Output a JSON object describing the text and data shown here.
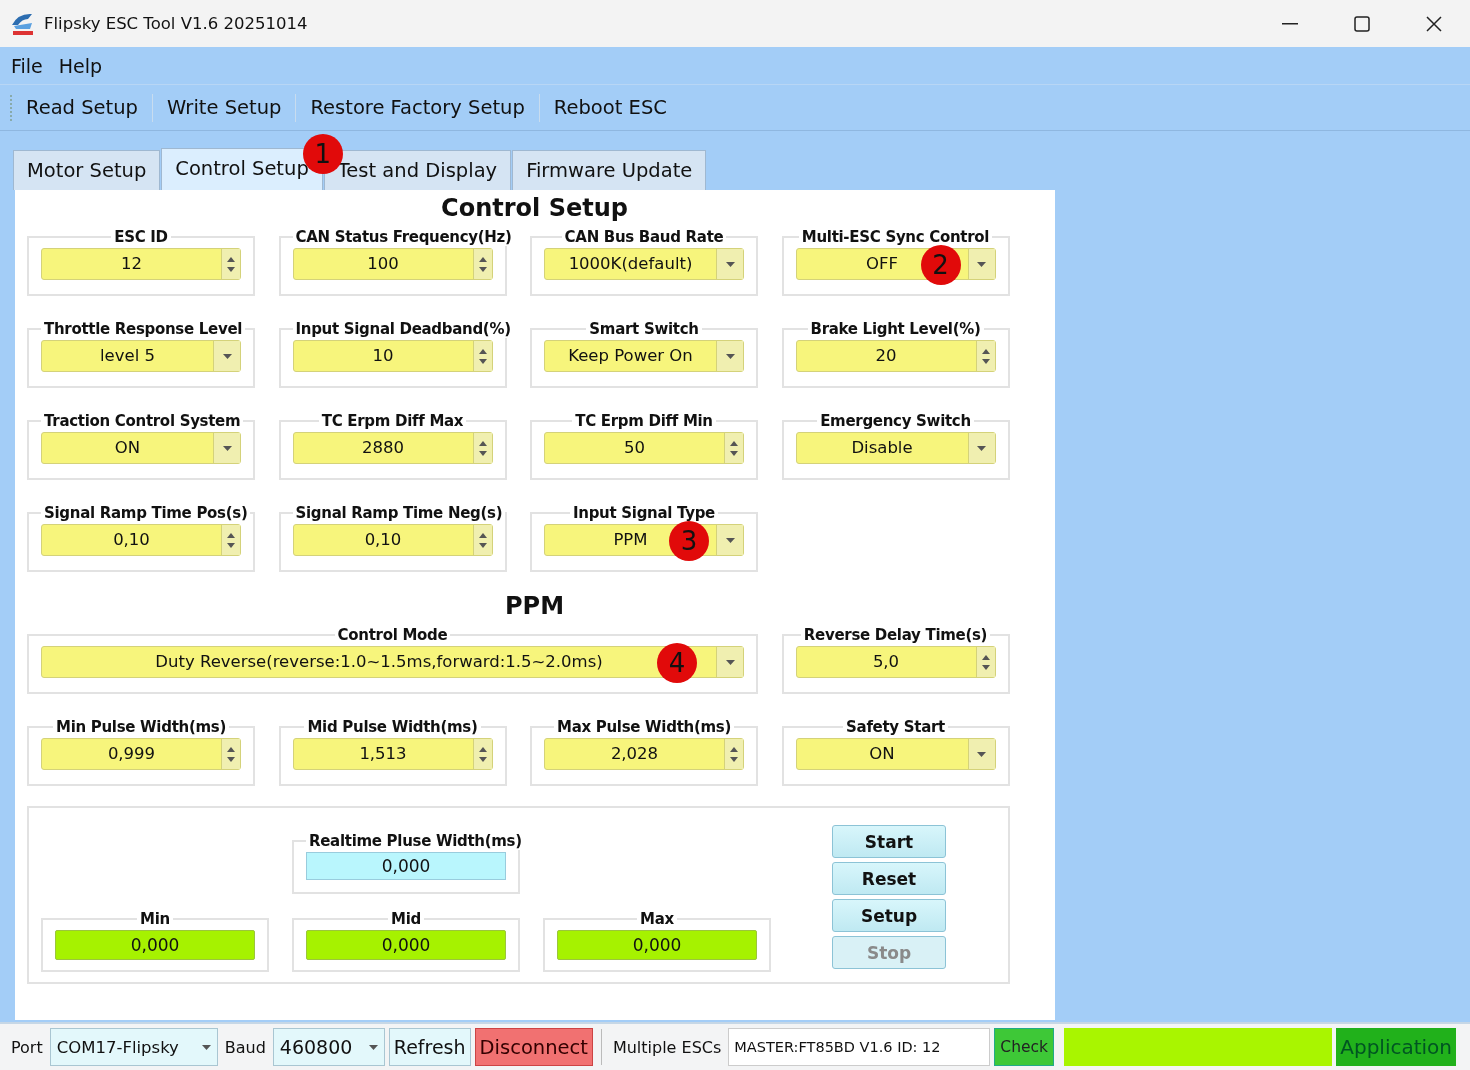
{
  "window": {
    "title": "Flipsky ESC Tool V1.6 20251014"
  },
  "menu": [
    "File",
    "Help"
  ],
  "toolbar": [
    "Read Setup",
    "Write Setup",
    "Restore Factory Setup",
    "Reboot ESC"
  ],
  "tabs": [
    {
      "label": "Motor Setup",
      "selected": false
    },
    {
      "label": "Control Setup",
      "selected": true,
      "callout": "1"
    },
    {
      "label": "Test and Display",
      "selected": false
    },
    {
      "label": "Firmware Update",
      "selected": false
    }
  ],
  "sections": [
    {
      "title": "Control Setup",
      "fields": [
        {
          "label": "ESC ID",
          "value": "12",
          "kind": "spin"
        },
        {
          "label": "CAN Status Frequency(Hz)",
          "value": "100",
          "kind": "spin"
        },
        {
          "label": "CAN Bus Baud Rate",
          "value": "1000K(default)",
          "kind": "combo"
        },
        {
          "label": "Multi-ESC Sync Control",
          "value": "OFF",
          "kind": "combo",
          "callout": "2"
        },
        {
          "label": "Throttle Response Level",
          "value": "level 5",
          "kind": "combo"
        },
        {
          "label": "Input Signal Deadband(%)",
          "value": "10",
          "kind": "spin"
        },
        {
          "label": "Smart Switch",
          "value": "Keep Power On",
          "kind": "combo"
        },
        {
          "label": "Brake Light Level(%)",
          "value": "20",
          "kind": "spin"
        },
        {
          "label": "Traction Control System",
          "value": "ON",
          "kind": "combo"
        },
        {
          "label": "TC Erpm Diff Max",
          "value": "2880",
          "kind": "spin"
        },
        {
          "label": "TC Erpm Diff Min",
          "value": "50",
          "kind": "spin"
        },
        {
          "label": "Emergency Switch",
          "value": "Disable",
          "kind": "combo"
        },
        {
          "label": "Signal Ramp Time Pos(s)",
          "value": "0,10",
          "kind": "spin"
        },
        {
          "label": "Signal Ramp Time Neg(s)",
          "value": "0,10",
          "kind": "spin"
        },
        {
          "label": "Input Signal Type",
          "value": "PPM",
          "kind": "combo",
          "callout": "3"
        }
      ]
    },
    {
      "title": "PPM",
      "fields": [
        {
          "label": "Control Mode",
          "value": "Duty Reverse(reverse:1.0~1.5ms,forward:1.5~2.0ms)",
          "kind": "wide",
          "callout": "4"
        },
        {
          "label": "Reverse Delay Time(s)",
          "value": "5,0",
          "kind": "spin"
        },
        {
          "label": "Min Pulse Width(ms)",
          "value": "0,999",
          "kind": "spin"
        },
        {
          "label": "Mid Pulse Width(ms)",
          "value": "1,513",
          "kind": "spin"
        },
        {
          "label": "Max Pulse Width(ms)",
          "value": "2,028",
          "kind": "spin"
        },
        {
          "label": "Safety Start",
          "value": "ON",
          "kind": "combo"
        }
      ]
    }
  ],
  "realtime": {
    "label": "Realtime Pluse Width(ms)",
    "value": "0,000",
    "readings": [
      {
        "label": "Min",
        "value": "0,000"
      },
      {
        "label": "Mid",
        "value": "0,000"
      },
      {
        "label": "Max",
        "value": "0,000"
      }
    ],
    "buttons": [
      {
        "label": "Start",
        "disabled": false
      },
      {
        "label": "Reset",
        "disabled": false
      },
      {
        "label": "Setup",
        "disabled": false
      },
      {
        "label": "Stop",
        "disabled": true
      }
    ]
  },
  "status_bar": {
    "port_label": "Port",
    "port": "COM17-Flipsky",
    "baud_label": "Baud",
    "baud": "460800",
    "refresh": "Refresh",
    "disconnect": "Disconnect",
    "multiple_label": "Multiple ESCs",
    "multiple_value": "MASTER:FT85BD V1.6 ID: 12",
    "check": "Check",
    "mode": "Application"
  }
}
